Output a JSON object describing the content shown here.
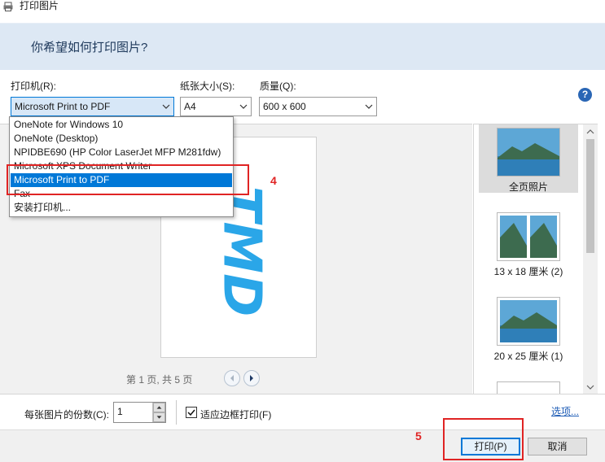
{
  "window": {
    "title": "打印图片",
    "icon": "printer-icon"
  },
  "header": {
    "question": "你希望如何打印图片?"
  },
  "printer": {
    "label": "打印机(R):",
    "selected": "Microsoft Print to PDF"
  },
  "paper_size": {
    "label": "纸张大小(S):",
    "selected": "A4"
  },
  "quality": {
    "label": "质量(Q):",
    "selected": "600 x 600"
  },
  "dropdown": {
    "options": [
      "OneNote for Windows 10",
      "OneNote (Desktop)",
      "NPIDBE690 (HP Color LaserJet MFP M281fdw)",
      "Microsoft XPS Document Writer",
      "Microsoft Print to PDF",
      "Fax",
      "安装打印机..."
    ],
    "selected_index": 4
  },
  "preview": {
    "page_indicator": "第 1 页, 共 5 页",
    "image_text": "TMD",
    "image_color": "#2aa6e8"
  },
  "layouts": [
    {
      "caption": "全页照片",
      "selected": true
    },
    {
      "caption": "13 x 18 厘米 (2)",
      "selected": false
    },
    {
      "caption": "20 x 25 厘米 (1)",
      "selected": false
    }
  ],
  "copies": {
    "label": "每张图片的份数(C):",
    "value": "1"
  },
  "fit": {
    "label": "适应边框打印(F)",
    "checked": true
  },
  "options_link": "选项...",
  "buttons": {
    "print": "打印(P)",
    "cancel": "取消"
  },
  "annotations": {
    "step4": "4",
    "step5": "5",
    "color": "#e02424"
  }
}
